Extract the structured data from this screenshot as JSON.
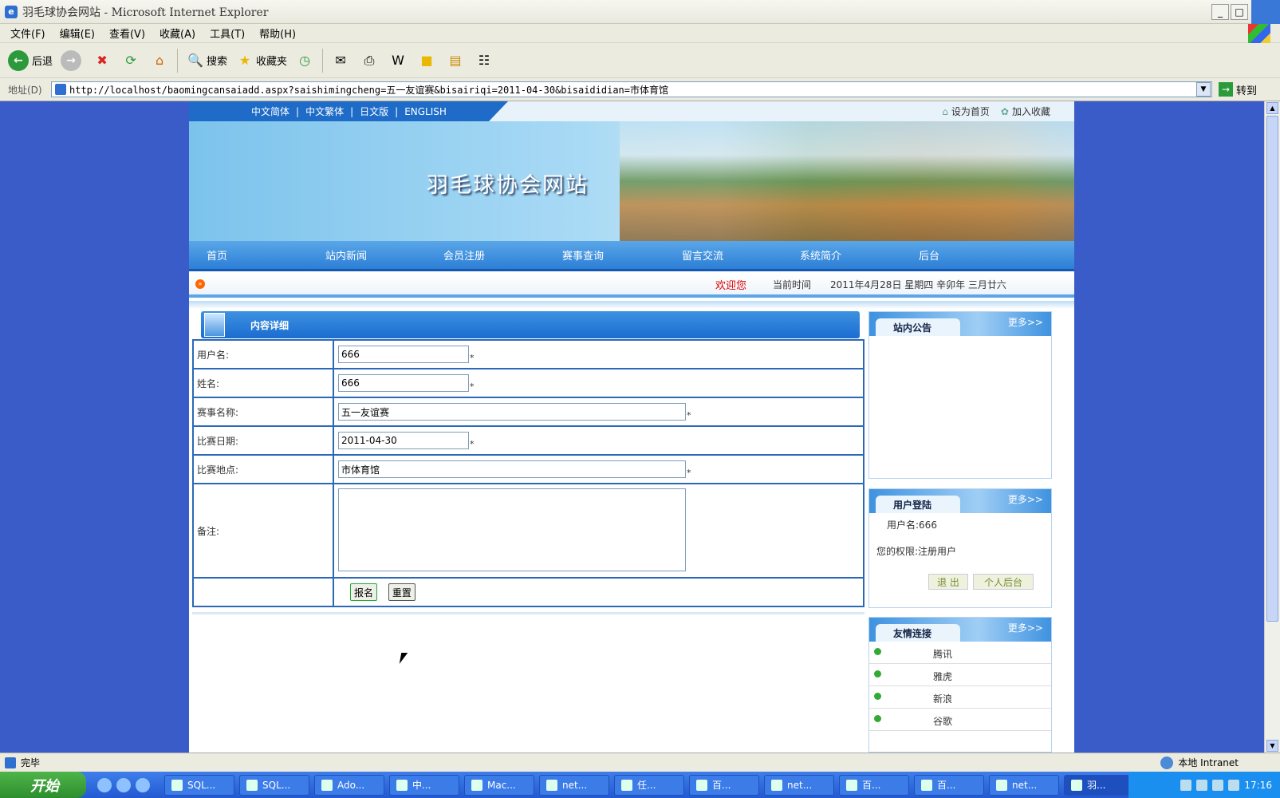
{
  "window": {
    "title": "羽毛球协会网站 - Microsoft Internet Explorer",
    "btn_minimize": "_",
    "btn_maximize": "□"
  },
  "menubar": {
    "items": [
      "文件(F)",
      "编辑(E)",
      "查看(V)",
      "收藏(A)",
      "工具(T)",
      "帮助(H)"
    ]
  },
  "toolbar": {
    "back": "后退",
    "search": "搜索",
    "favorites": "收藏夹"
  },
  "address": {
    "label": "地址(D)",
    "url": "http://localhost/baomingcansaiadd.aspx?saishimingcheng=五一友谊赛&bisairiqi=2011-04-30&bisaididian=市体育馆",
    "go": "转到"
  },
  "site": {
    "languages": [
      "中文简体",
      "中文繁体",
      "日文版",
      "ENGLISH"
    ],
    "set_home": "设为首页",
    "add_fav": "加入收藏",
    "banner_title": "羽毛球协会网站",
    "nav": [
      "首页",
      "站内新闻",
      "会员注册",
      "赛事查询",
      "留言交流",
      "系统简介",
      "后台"
    ],
    "welcome": "欢迎您",
    "time_label": "当前时间",
    "time_value": "2011年4月28日 星期四 辛卯年 三月廿六",
    "panel_title": "内容详细",
    "form": {
      "username_label": "用户名:",
      "username": "666",
      "name_label": "姓名:",
      "name": "666",
      "event_label": "赛事名称:",
      "event": "五一友谊赛",
      "date_label": "比赛日期:",
      "date": "2011-04-30",
      "place_label": "比赛地点:",
      "place": "市体育馆",
      "remark_label": "备注:",
      "remark": "",
      "required": "*",
      "submit": "报名",
      "reset": "重置"
    },
    "notice": {
      "title": "站内公告",
      "more": "更多>>"
    },
    "login": {
      "title": "用户登陆",
      "more": "更多>>",
      "user_line": "用户名:666",
      "role_line": "您的权限:注册用户",
      "logout": "退 出",
      "personal": "个人后台"
    },
    "links": {
      "title": "友情连接",
      "more": "更多>>",
      "items": [
        "腾讯",
        "雅虎",
        "新浪",
        "谷歌"
      ]
    }
  },
  "status": {
    "text": "完毕",
    "zone": "本地 Intranet"
  },
  "taskbar": {
    "start": "开始",
    "tasks": [
      "SQL...",
      "SQL...",
      "Ado...",
      "中...",
      "Mac...",
      "net...",
      "任...",
      "百...",
      "net...",
      "百...",
      "百...",
      "net...",
      "羽..."
    ],
    "clock": "17:16"
  }
}
